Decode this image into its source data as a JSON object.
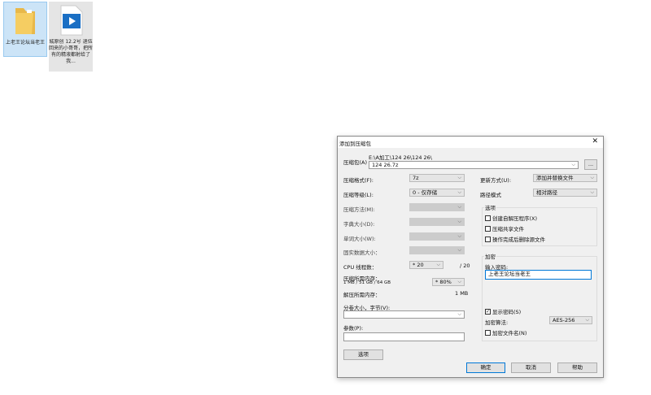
{
  "desktop": {
    "icons": [
      {
        "label": "上老王论坛当老王",
        "type": "folder"
      },
      {
        "label": "城原创 12.2号 退伍回来的小哥哥，把所有的精液都射给了我...",
        "type": "video"
      }
    ]
  },
  "dialog": {
    "title": "添加到压缩包",
    "archive_label": "压缩包(A)",
    "archive_path": "E:\\A加工\\124 26\\124 26\\",
    "archive_name": "124 26.7z",
    "browse_label": "...",
    "left": {
      "format_label": "压缩格式(F):",
      "format_value": "7z",
      "level_label": "压缩等级(L):",
      "level_value": "0 - 仅存储",
      "method_label": "压缩方法(M):",
      "dict_label": "字典大小(D):",
      "word_label": "单词大小(W):",
      "solid_label": "固实数据大小：",
      "cpu_label": "CPU 线程数：",
      "cpu_value": "* 20",
      "cpu_max": "/ 20",
      "mem_label": "压缩所需内存：",
      "mem_sub": "1 MB / 51 GB / 64 GB",
      "mem_value": "* 80%",
      "decomp_label": "解压所需内存：",
      "decomp_value": "1 MB",
      "split_label": "分卷大小，字节(V):",
      "split_value": "",
      "params_label": "参数(P):",
      "params_value": "",
      "options_button": "选项"
    },
    "right": {
      "update_label": "更新方式(U):",
      "update_value": "添加并替换文件",
      "pathmode_label": "路径模式",
      "pathmode_value": "相对路径",
      "options_title": "选项",
      "opt_sfx": "创建自解压程序(X)",
      "opt_shared": "压缩共享文件",
      "opt_delete": "操作完成后删除源文件",
      "enc_title": "加密",
      "pwd_label": "输入密码:",
      "pwd_value": "上老王论坛当老王",
      "show_pwd": "显示密码(S)",
      "show_pwd_checked": true,
      "alg_label": "加密算法:",
      "alg_value": "AES-256",
      "enc_names": "加密文件名(N)"
    },
    "ok": "确定",
    "cancel": "取消",
    "help": "帮助"
  }
}
